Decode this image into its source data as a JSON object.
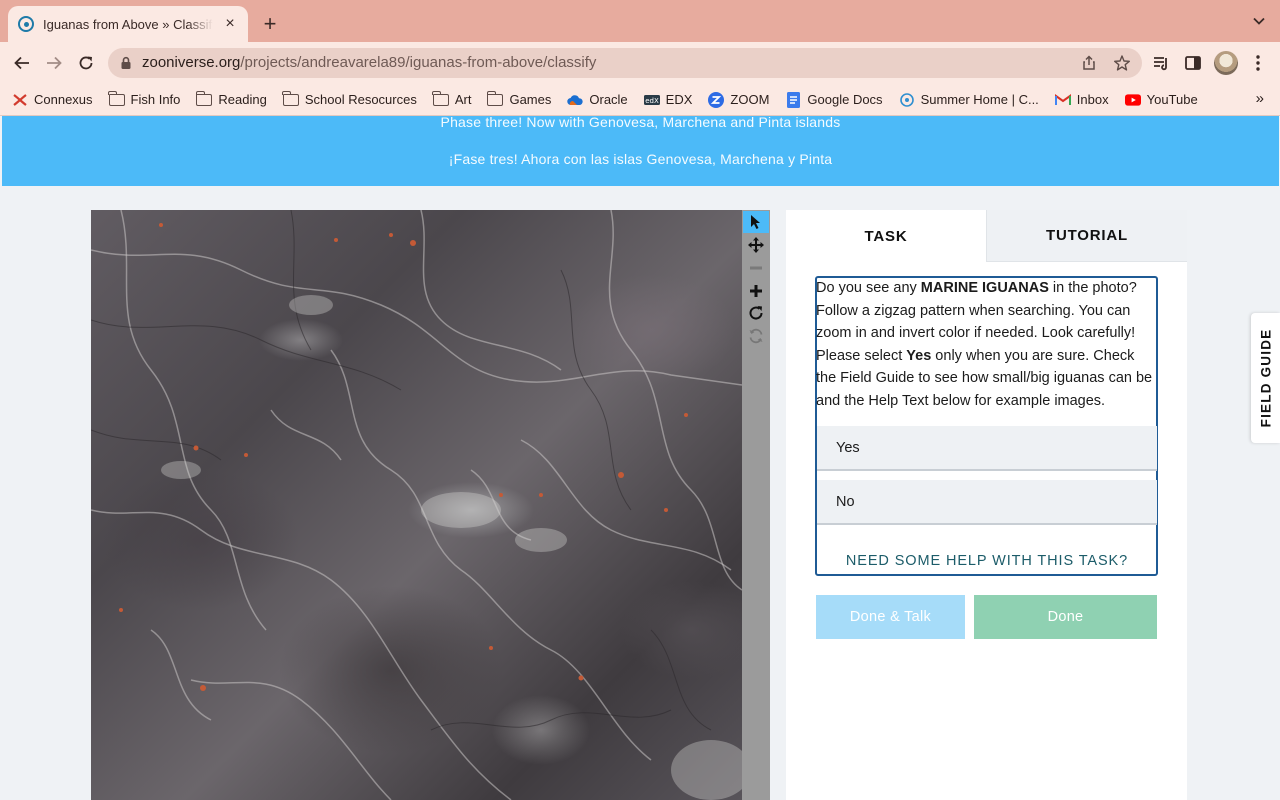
{
  "browser": {
    "tab": {
      "title": "Iguanas from Above » Classify",
      "close": "×"
    },
    "new_tab": "+",
    "url": {
      "domain": "zooniverse.org",
      "path": "/projects/andreavarela89/iguanas-from-above/classify"
    },
    "bookmarks": [
      {
        "label": "Connexus",
        "icon": "connexus-icon"
      },
      {
        "label": "Fish Info",
        "icon": "folder-icon"
      },
      {
        "label": "Reading",
        "icon": "folder-icon"
      },
      {
        "label": "School Resocurces",
        "icon": "folder-icon"
      },
      {
        "label": "Art",
        "icon": "folder-icon"
      },
      {
        "label": "Games",
        "icon": "folder-icon"
      },
      {
        "label": "Oracle",
        "icon": "oracle-cloud-icon"
      },
      {
        "label": "EDX",
        "icon": "edx-icon"
      },
      {
        "label": "ZOOM",
        "icon": "zoom-icon"
      },
      {
        "label": "Google Docs",
        "icon": "google-docs-icon"
      },
      {
        "label": "Summer Home | C...",
        "icon": "summer-home-icon"
      },
      {
        "label": "Inbox",
        "icon": "gmail-icon"
      },
      {
        "label": "YouTube",
        "icon": "youtube-icon"
      }
    ],
    "more_bookmarks": "»"
  },
  "banner": {
    "line1": "Phase three! Now with Genovesa, Marchena and Pinta islands",
    "line2": "¡Fase tres! Ahora con las islas Genovesa, Marchena y Pinta"
  },
  "viewer_controls": [
    {
      "name": "pointer-tool",
      "icon": "cursor-arrow-icon",
      "active": true
    },
    {
      "name": "pan-tool",
      "icon": "move-arrows-icon",
      "active": false
    },
    {
      "name": "zoom-out",
      "icon": "minus-icon",
      "active": false,
      "disabled": true
    },
    {
      "name": "zoom-in",
      "icon": "plus-icon",
      "active": false
    },
    {
      "name": "rotate",
      "icon": "rotate-icon",
      "active": false
    },
    {
      "name": "reset",
      "icon": "refresh-icon",
      "active": false,
      "disabled": true
    }
  ],
  "panel": {
    "tabs": {
      "task": "TASK",
      "tutorial": "TUTORIAL"
    },
    "question": {
      "p1": "Do you see any ",
      "b1": "MARINE IGUANAS",
      "p2": " in the photo? Follow a zigzag pattern when searching. You can zoom in and invert color if needed. Look carefully! Please select ",
      "b2": "Yes",
      "p3": " only when you are sure. Check the Field Guide to see how small/big iguanas can be and the Help Text below for example images."
    },
    "answers": {
      "yes": "Yes",
      "no": "No"
    },
    "help": "NEED SOME HELP WITH THIS TASK?",
    "buttons": {
      "done_talk": "Done & Talk",
      "done": "Done"
    }
  },
  "field_guide": "FIELD GUIDE",
  "colors": {
    "banner": "#4cbaf8",
    "done_talk": "#a6dcf9",
    "done": "#8fd1b2",
    "task_border": "#1f5b95",
    "help_text": "#1c5c69"
  }
}
